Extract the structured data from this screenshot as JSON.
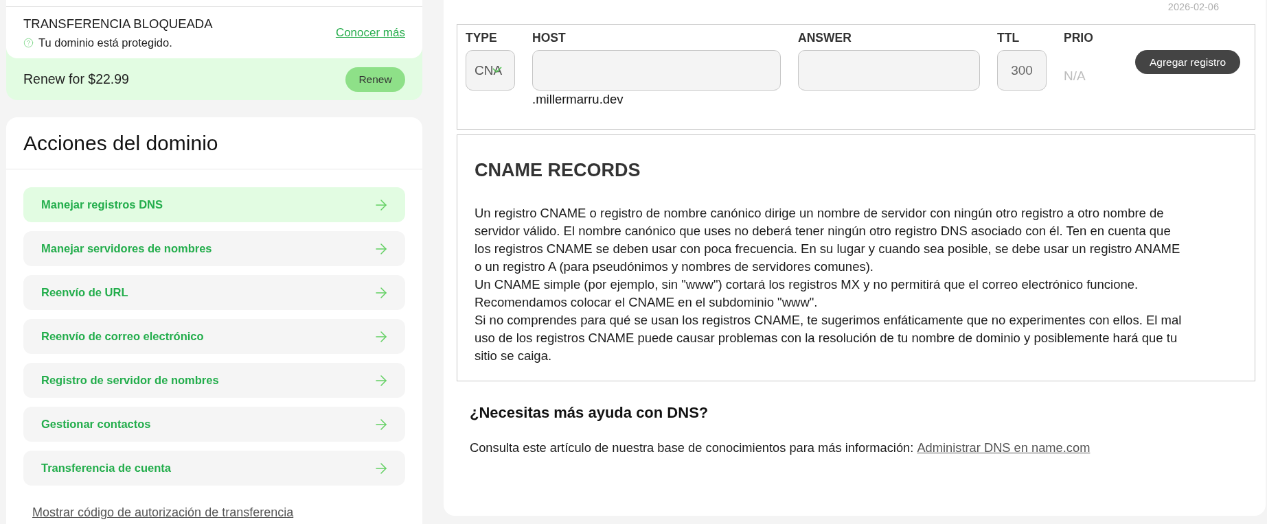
{
  "transfer_status": {
    "title": "TRANSFERENCIA BLOQUEADA",
    "note": "Tu dominio está protegido.",
    "link": "Conocer más"
  },
  "renewal": {
    "text": "Renew for $22.99",
    "button": "Renew"
  },
  "domain_actions": {
    "title": "Acciones del dominio",
    "items": [
      {
        "label": "Manejar registros DNS",
        "selected": true
      },
      {
        "label": "Manejar servidores de nombres",
        "selected": false
      },
      {
        "label": "Reenvío de URL",
        "selected": false
      },
      {
        "label": "Reenvío de correo electrónico",
        "selected": false
      },
      {
        "label": "Registro de servidor de nombres",
        "selected": false
      },
      {
        "label": "Gestionar contactos",
        "selected": false
      },
      {
        "label": "Transferencia de cuenta",
        "selected": false
      }
    ],
    "link": "Mostrar código de autorización de transferencia"
  },
  "date": "2026-02-06",
  "record_form": {
    "fields": [
      {
        "kind": "select",
        "label": "TYPE",
        "value": "CNA"
      },
      {
        "kind": "input",
        "label": "HOST",
        "suffix": ".millermarru.dev"
      },
      {
        "kind": "input",
        "label": "ANSWER"
      },
      {
        "kind": "input",
        "label": "TTL",
        "value": "300"
      },
      {
        "kind": "text",
        "label": "PRIO",
        "value": "N/A"
      }
    ],
    "button": "Agregar registro"
  },
  "info": {
    "title": "CNAME RECORDS",
    "paragraphs": [
      "Un registro CNAME o registro de nombre canónico dirige un nombre de servidor con ningún otro registro a otro nombre de servidor válido. El nombre canónico que uses no deberá tener ningún otro registro DNS asociado con él. Ten en cuenta que los registros CNAME se deben usar con poca frecuencia. En su lugar y cuando sea posible, se debe usar un registro ANAME o un registro A (para pseudónimos y nombres de servidores comunes).",
      "Un CNAME simple (por ejemplo, sin \"www\") cortará los registros MX y no permitirá que el correo electrónico funcione.",
      "Recomendamos colocar el CNAME en el subdominio \"www\".",
      "Si no comprendes para qué se usan los registros CNAME, te sugerimos enfáticamente que no experimentes con ellos. El mal uso de los registros CNAME puede causar problemas con la resolución de tu nombre de dominio y posiblemente hará que tu sitio se caiga."
    ]
  },
  "help": {
    "title": "¿Necesitas más ayuda con DNS?",
    "text": "Consulta este artículo de nuestra base de conocimientos para más información:",
    "link": "Administrar DNS en name.com"
  }
}
